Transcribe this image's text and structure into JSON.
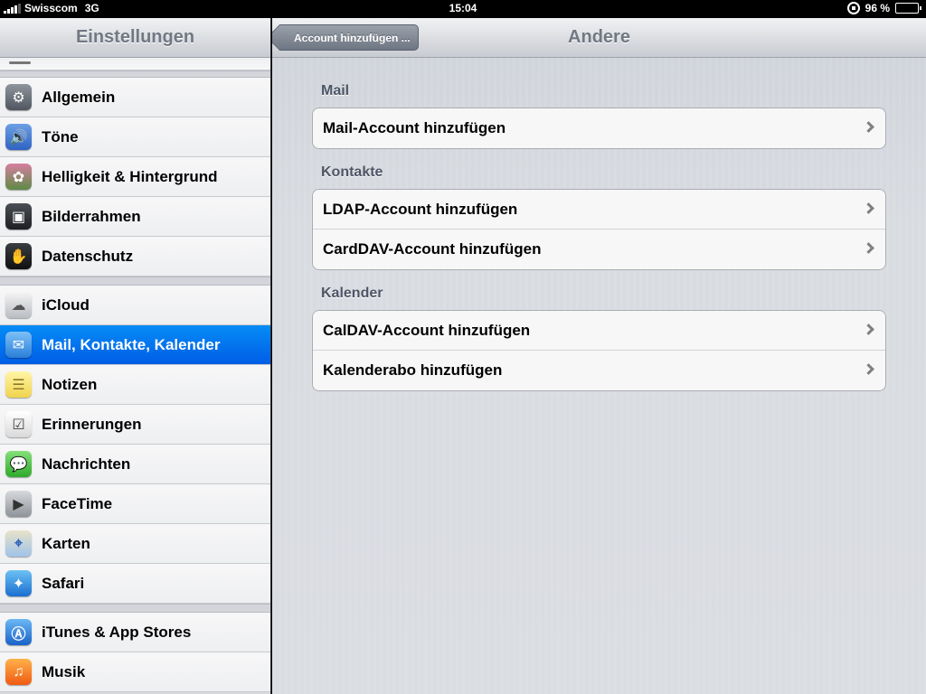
{
  "status_bar": {
    "carrier": "Swisscom",
    "network": "3G",
    "time": "15:04",
    "battery": "96 %"
  },
  "master": {
    "title": "Einstellungen",
    "items": [
      {
        "label": "Allgemein",
        "icon": "gear-icon"
      },
      {
        "label": "Töne",
        "icon": "speaker-icon"
      },
      {
        "label": "Helligkeit & Hintergrund",
        "icon": "flower-icon"
      },
      {
        "label": "Bilderrahmen",
        "icon": "picture-frame-icon"
      },
      {
        "label": "Datenschutz",
        "icon": "hand-icon"
      },
      {
        "label": "iCloud",
        "icon": "cloud-icon"
      },
      {
        "label": "Mail, Kontakte, Kalender",
        "icon": "mail-icon"
      },
      {
        "label": "Notizen",
        "icon": "notes-icon"
      },
      {
        "label": "Erinnerungen",
        "icon": "reminders-icon"
      },
      {
        "label": "Nachrichten",
        "icon": "message-bubble-icon"
      },
      {
        "label": "FaceTime",
        "icon": "video-camera-icon"
      },
      {
        "label": "Karten",
        "icon": "map-icon"
      },
      {
        "label": "Safari",
        "icon": "compass-icon"
      },
      {
        "label": "iTunes & App Stores",
        "icon": "app-store-icon"
      },
      {
        "label": "Musik",
        "icon": "music-note-icon"
      }
    ],
    "selected": "Mail, Kontakte, Kalender"
  },
  "detail": {
    "title": "Andere",
    "back_label": "Account hinzufügen ...",
    "sections": [
      {
        "header": "Mail",
        "rows": [
          "Mail-Account hinzufügen"
        ]
      },
      {
        "header": "Kontakte",
        "rows": [
          "LDAP-Account hinzufügen",
          "CardDAV-Account hinzufügen"
        ]
      },
      {
        "header": "Kalender",
        "rows": [
          "CalDAV-Account hinzufügen",
          "Kalenderabo hinzufügen"
        ]
      }
    ]
  },
  "colors": {
    "selection": "#0a6df0",
    "nav_title": "#717884",
    "section_header": "#4d5666"
  }
}
